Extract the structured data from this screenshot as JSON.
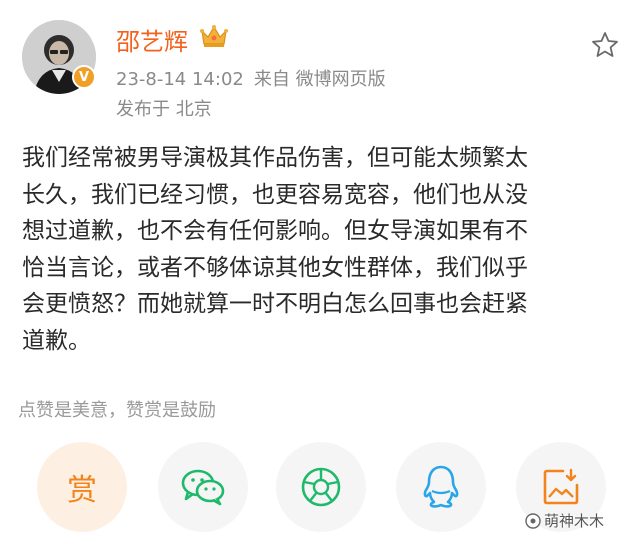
{
  "post": {
    "username": "邵艺辉",
    "time": "23-8-14 14:02",
    "source": "来自 微博网页版",
    "location": "发布于 北京",
    "verified_badge": "V",
    "lines": [
      "我们经常被男导演极其作品伤害，但可能太频繁太",
      "长久，我们已经习惯，也更容易宽容，他们也从没",
      "想过道歉，也不会有任何影响。但女导演如果有不",
      "恰当言论，或者不够体谅其他女性群体，我们似乎",
      "会更愤怒？而她就算一时不明白怎么回事也会赶紧",
      "道歉。"
    ]
  },
  "reward": {
    "caption": "点赞是美意，赞赏是鼓励",
    "button_label": "赏"
  },
  "actions": [
    "reward-button",
    "wechat-icon",
    "moments-icon",
    "qq-icon",
    "save-image-icon"
  ],
  "watermark": "萌神木木",
  "colors": {
    "username": "#f2621d",
    "meta": "#8a8a8a",
    "reward_orange": "#f2841e",
    "wechat_green": "#1fb96b",
    "qq_blue": "#2aa6e8",
    "save_orange": "#f2841e",
    "badge_gold": "#f0a028"
  }
}
